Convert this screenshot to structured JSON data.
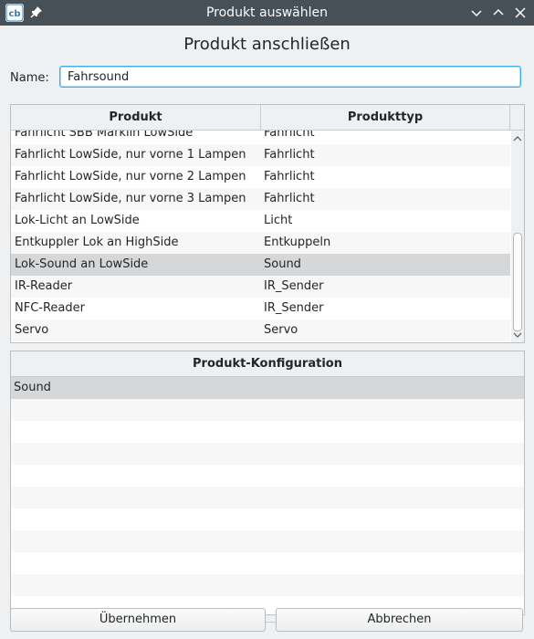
{
  "window": {
    "title": "Produkt auswählen",
    "app_icon": "app-logo-icon",
    "controls": [
      "chevron-down-icon",
      "chevron-up-icon",
      "close-icon"
    ]
  },
  "dialog": {
    "heading": "Produkt anschließen",
    "name_label": "Name:",
    "name_value": "Fahrsound"
  },
  "product_table": {
    "columns": [
      "Produkt",
      "Produkttyp"
    ],
    "rows": [
      {
        "produkt": "Fahrlicht SBB Märklin LowSide",
        "typ": "Fahrlicht"
      },
      {
        "produkt": "Fahrlicht LowSide, nur vorne 1 Lampen",
        "typ": "Fahrlicht"
      },
      {
        "produkt": "Fahrlicht LowSide, nur vorne 2 Lampen",
        "typ": "Fahrlicht"
      },
      {
        "produkt": "Fahrlicht LowSide, nur vorne 3 Lampen",
        "typ": "Fahrlicht"
      },
      {
        "produkt": "Lok-Licht an LowSide",
        "typ": "Licht"
      },
      {
        "produkt": "Entkuppler Lok an HighSide",
        "typ": "Entkuppeln"
      },
      {
        "produkt": "Lok-Sound an LowSide",
        "typ": "Sound"
      },
      {
        "produkt": "IR-Reader",
        "typ": "IR_Sender"
      },
      {
        "produkt": "NFC-Reader",
        "typ": "IR_Sender"
      },
      {
        "produkt": "Servo",
        "typ": "Servo"
      }
    ],
    "selected_index": 6
  },
  "config_table": {
    "header": "Produkt-Konfiguration",
    "rows": [
      "Sound"
    ]
  },
  "buttons": {
    "ok": "Übernehmen",
    "cancel": "Abbrechen"
  },
  "colors": {
    "titlebar": "#475057",
    "accent": "#3daee9",
    "selection": "#d6d7d8"
  }
}
